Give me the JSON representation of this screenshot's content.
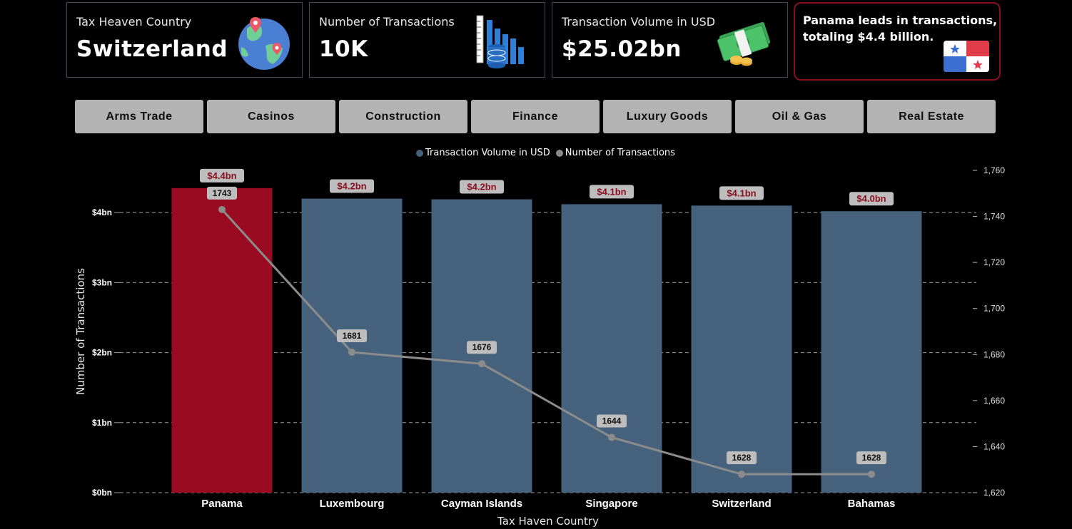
{
  "kpis": [
    {
      "label": "Tax Heaven Country",
      "value": "Switzerland",
      "icon": "globe-icon"
    },
    {
      "label": "Number of Transactions",
      "value": "10K",
      "icon": "database-chart-icon"
    },
    {
      "label": "Transaction Volume in USD",
      "value": "$25.02bn",
      "icon": "money-icon"
    }
  ],
  "callout": {
    "text": "Panama leads in transactions, totaling $4.4 billion.",
    "icon": "panama-flag-icon"
  },
  "filters": [
    "Arms Trade",
    "Casinos",
    "Construction",
    "Finance",
    "Luxury Goods",
    "Oil & Gas",
    "Real Estate"
  ],
  "legend": {
    "series1": "Transaction Volume in USD",
    "series2": "Number of Transactions"
  },
  "colors": {
    "highlight_bar": "#9a0a20",
    "bar": "#46627d",
    "line": "#8c8c8c",
    "data_label_bg": "#bdbdbd",
    "bar_label_text": "#8a0e1f",
    "callout_border": "#8a0e1f"
  },
  "chart_data": {
    "type": "bar",
    "categories": [
      "Panama",
      "Luxembourg",
      "Cayman Islands",
      "Singapore",
      "Switzerland",
      "Bahamas"
    ],
    "series": [
      {
        "name": "Transaction Volume in USD",
        "type": "bar",
        "axis": "left",
        "values": [
          4.35,
          4.2,
          4.19,
          4.12,
          4.1,
          4.02
        ],
        "labels": [
          "$4.4bn",
          "$4.2bn",
          "$4.2bn",
          "$4.1bn",
          "$4.1bn",
          "$4.0bn"
        ]
      },
      {
        "name": "Number of Transactions",
        "type": "line",
        "axis": "right",
        "values": [
          1743,
          1681,
          1676,
          1644,
          1628,
          1628
        ],
        "labels": [
          "1743",
          "1681",
          "1676",
          "1644",
          "1628",
          "1628"
        ]
      }
    ],
    "xlabel": "Tax Haven Country",
    "ylabel": "Number of Transactions",
    "ylim": [
      0,
      4.6
    ],
    "y2lim": [
      1620,
      1760
    ],
    "yticks": [
      0,
      1,
      2,
      3,
      4
    ],
    "ytick_labels": [
      "$0bn",
      "$1bn",
      "$2bn",
      "$3bn",
      "$4bn"
    ],
    "y2ticks": [
      1620,
      1640,
      1660,
      1680,
      1700,
      1720,
      1740,
      1760
    ],
    "y2tick_labels": [
      "1,620",
      "1,640",
      "1,660",
      "1,680",
      "1,700",
      "1,720",
      "1,740",
      "1,760"
    ],
    "grid": true,
    "legend_position": "top-center",
    "highlight_category": "Panama"
  }
}
